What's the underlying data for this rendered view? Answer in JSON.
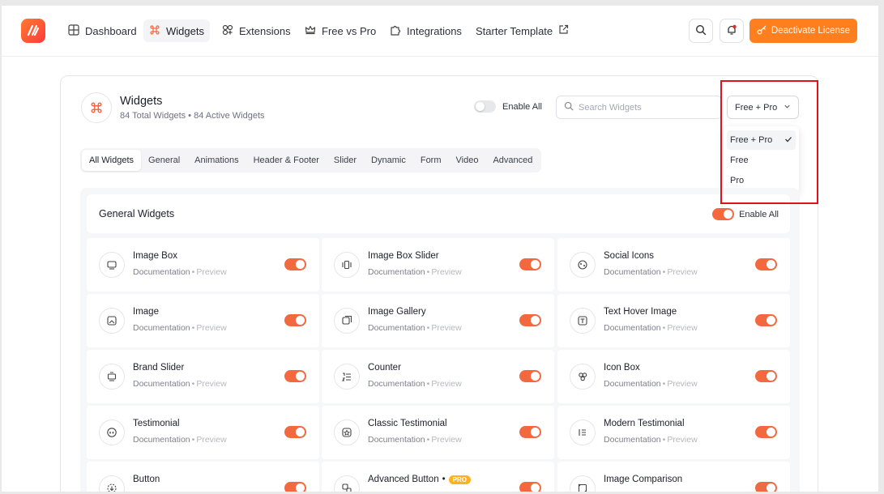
{
  "nav": {
    "items": [
      {
        "label": "Dashboard",
        "icon": "dashboard-grid-icon"
      },
      {
        "label": "Widgets",
        "icon": "command-icon",
        "active": true
      },
      {
        "label": "Extensions",
        "icon": "extensions-icon"
      },
      {
        "label": "Free vs Pro",
        "icon": "crown-icon"
      },
      {
        "label": "Integrations",
        "icon": "puzzle-icon"
      },
      {
        "label": "Starter Template",
        "icon": "external-link-icon"
      }
    ],
    "deactivate_label": "Deactivate License"
  },
  "header": {
    "title": "Widgets",
    "subtitle": "84 Total Widgets • 84 Active Widgets",
    "enable_all_label": "Enable All",
    "search_placeholder": "Search Widgets",
    "filter_selected": "Free + Pro",
    "filter_options": [
      "Free + Pro",
      "Free",
      "Pro"
    ]
  },
  "tabs": [
    "All Widgets",
    "General",
    "Animations",
    "Header & Footer",
    "Slider",
    "Dynamic",
    "Form",
    "Video",
    "Advanced"
  ],
  "section": {
    "title": "General Widgets",
    "enable_all_label": "Enable All"
  },
  "link_labels": {
    "documentation": "Documentation",
    "preview": "Preview",
    "separator": "•"
  },
  "widgets": [
    {
      "name": "Image Box",
      "icon": "image-box-icon"
    },
    {
      "name": "Image Box Slider",
      "icon": "slider-icon"
    },
    {
      "name": "Social Icons",
      "icon": "social-icon"
    },
    {
      "name": "Image",
      "icon": "image-icon"
    },
    {
      "name": "Image Gallery",
      "icon": "gallery-icon"
    },
    {
      "name": "Text Hover Image",
      "icon": "text-icon"
    },
    {
      "name": "Brand Slider",
      "icon": "brand-icon"
    },
    {
      "name": "Counter",
      "icon": "counter-icon"
    },
    {
      "name": "Icon Box",
      "icon": "icon-box-icon"
    },
    {
      "name": "Testimonial",
      "icon": "quote-icon"
    },
    {
      "name": "Classic Testimonial",
      "icon": "badge-icon"
    },
    {
      "name": "Modern Testimonial",
      "icon": "list-icon"
    },
    {
      "name": "Button",
      "icon": "button-icon"
    },
    {
      "name": "Advanced Button",
      "icon": "advanced-button-icon",
      "badge": "PRO"
    },
    {
      "name": "Image Comparison",
      "icon": "compare-icon"
    }
  ],
  "colors": {
    "accent": "#f2683f",
    "deactivate": "#ff7f1f",
    "highlight": "#e0121a",
    "pro_badge": "#ffb21e"
  }
}
